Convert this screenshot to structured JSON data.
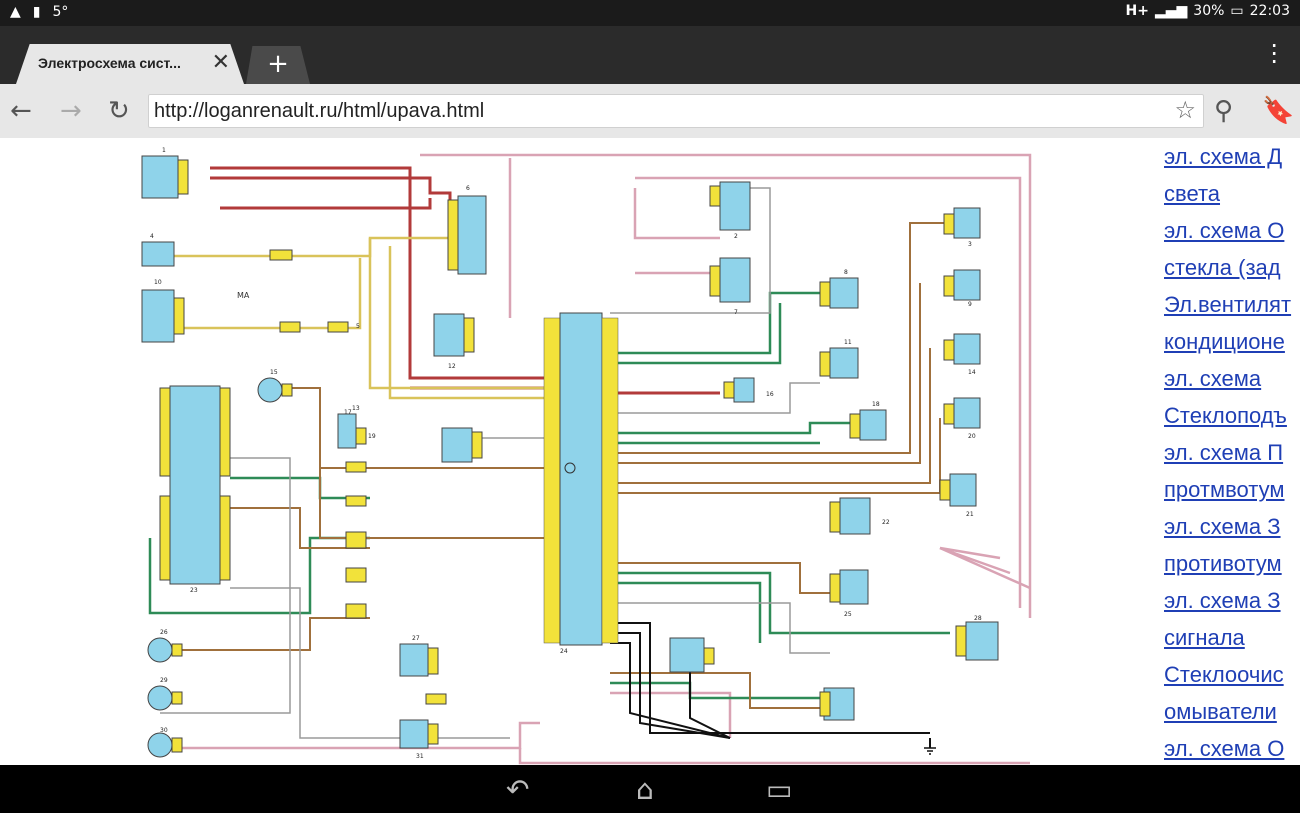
{
  "statusbar": {
    "left_badge": "5°",
    "network": "H+",
    "battery": "30%",
    "time": "22:03"
  },
  "browser": {
    "tab_title": "Электросхема сист...",
    "tab_close": "✕",
    "new_tab": "+",
    "url": "http://loganrenault.ru/html/upava.html"
  },
  "sidebar_links": [
    "эл. схема Д",
    "света",
    "эл. схема О",
    "стекла (зад",
    "Эл.вентилят",
    "кондиционе",
    "эл. схема",
    "Стеклоподъ",
    "эл. схема П",
    "протмвотум",
    "эл. схема З",
    "противотум",
    "эл. схема З",
    "сигнала",
    "Стеклоочис",
    "омыватели",
    "эл. схема О"
  ],
  "diagram": {
    "label_ma": "MA",
    "component_numbers": [
      "1",
      "2",
      "3",
      "4",
      "5",
      "6",
      "7",
      "8",
      "9",
      "10",
      "11",
      "12",
      "13",
      "14",
      "15",
      "16",
      "17",
      "18",
      "19",
      "20",
      "21",
      "22",
      "23",
      "24",
      "25",
      "26",
      "27",
      "28",
      "29",
      "30",
      "31"
    ]
  },
  "colors": {
    "wire_red": "#b23a3a",
    "wire_pink": "#d9a3b4",
    "wire_green": "#2e8b57",
    "wire_brown": "#a0703c",
    "wire_yellow": "#d9c35a",
    "wire_black": "#111111",
    "wire_gray": "#9a9a9a",
    "component_blue": "#8fd3ea",
    "connector_yellow": "#f2e23a",
    "link_blue": "#1f3fb5"
  }
}
